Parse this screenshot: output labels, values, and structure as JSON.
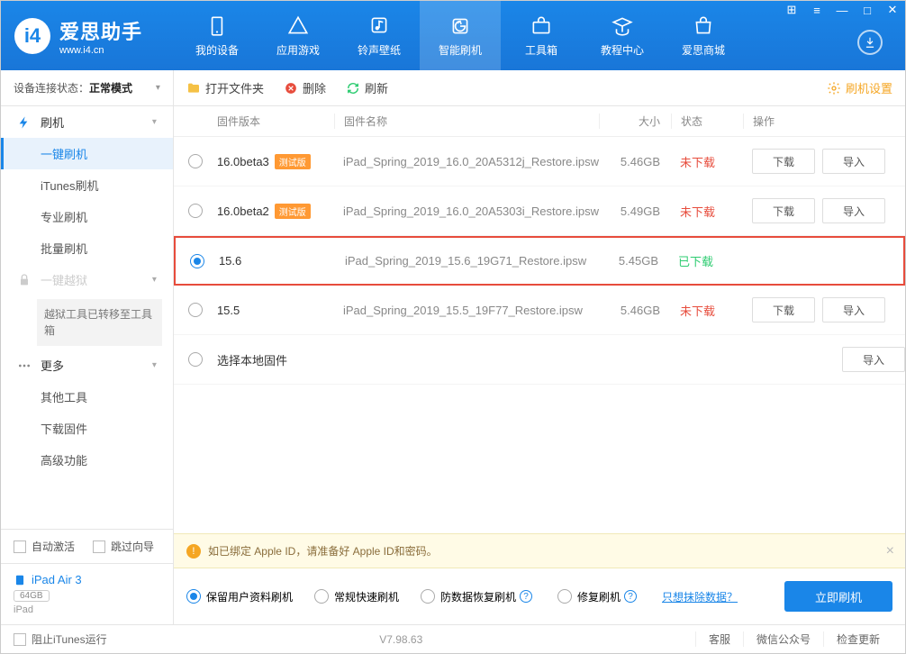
{
  "app": {
    "name": "爱思助手",
    "url": "www.i4.cn"
  },
  "window_controls": [
    "⊞",
    "≡",
    "—",
    "□",
    "✕"
  ],
  "nav": [
    {
      "label": "我的设备",
      "icon": "device"
    },
    {
      "label": "应用游戏",
      "icon": "apps"
    },
    {
      "label": "铃声壁纸",
      "icon": "music"
    },
    {
      "label": "智能刷机",
      "icon": "flash",
      "active": true
    },
    {
      "label": "工具箱",
      "icon": "tools"
    },
    {
      "label": "教程中心",
      "icon": "tutorial"
    },
    {
      "label": "爱思商城",
      "icon": "shop"
    }
  ],
  "sidebar": {
    "conn_label": "设备连接状态：",
    "conn_value": "正常模式",
    "groups": [
      {
        "title": "刷机",
        "icon": "flash",
        "items": [
          "一键刷机",
          "iTunes刷机",
          "专业刷机",
          "批量刷机"
        ],
        "active_index": 0
      },
      {
        "title": "一键越狱",
        "icon": "lock",
        "disabled": true,
        "notice": "越狱工具已转移至工具箱"
      },
      {
        "title": "更多",
        "icon": "more",
        "items": [
          "其他工具",
          "下载固件",
          "高级功能"
        ]
      }
    ],
    "auto_activate": "自动激活",
    "skip_guide": "跳过向导",
    "device": {
      "name": "iPad Air 3",
      "storage": "64GB",
      "type": "iPad"
    }
  },
  "toolbar": {
    "open": "打开文件夹",
    "delete": "删除",
    "refresh": "刷新",
    "settings": "刷机设置"
  },
  "table": {
    "headers": {
      "version": "固件版本",
      "name": "固件名称",
      "size": "大小",
      "status": "状态",
      "action": "操作"
    },
    "buttons": {
      "download": "下载",
      "import": "导入"
    },
    "local_fw": "选择本地固件",
    "rows": [
      {
        "version": "16.0beta3",
        "beta": "测试版",
        "name": "iPad_Spring_2019_16.0_20A5312j_Restore.ipsw",
        "size": "5.46GB",
        "status": "未下载",
        "status_cls": "not",
        "selected": false,
        "show_actions": true
      },
      {
        "version": "16.0beta2",
        "beta": "测试版",
        "name": "iPad_Spring_2019_16.0_20A5303i_Restore.ipsw",
        "size": "5.49GB",
        "status": "未下载",
        "status_cls": "not",
        "selected": false,
        "show_actions": true
      },
      {
        "version": "15.6",
        "beta": "",
        "name": "iPad_Spring_2019_15.6_19G71_Restore.ipsw",
        "size": "5.45GB",
        "status": "已下载",
        "status_cls": "done",
        "selected": true,
        "highlighted": true,
        "show_actions": false
      },
      {
        "version": "15.5",
        "beta": "",
        "name": "iPad_Spring_2019_15.5_19F77_Restore.ipsw",
        "size": "5.46GB",
        "status": "未下载",
        "status_cls": "not",
        "selected": false,
        "show_actions": true
      }
    ]
  },
  "warning": "如已绑定 Apple ID，请准备好 Apple ID和密码。",
  "flash": {
    "options": [
      "保留用户资料刷机",
      "常规快速刷机",
      "防数据恢复刷机",
      "修复刷机"
    ],
    "selected": 0,
    "erase_link": "只想抹除数据？",
    "button": "立即刷机"
  },
  "statusbar": {
    "stop_itunes": "阻止iTunes运行",
    "version": "V7.98.63",
    "links": [
      "客服",
      "微信公众号",
      "检查更新"
    ]
  }
}
